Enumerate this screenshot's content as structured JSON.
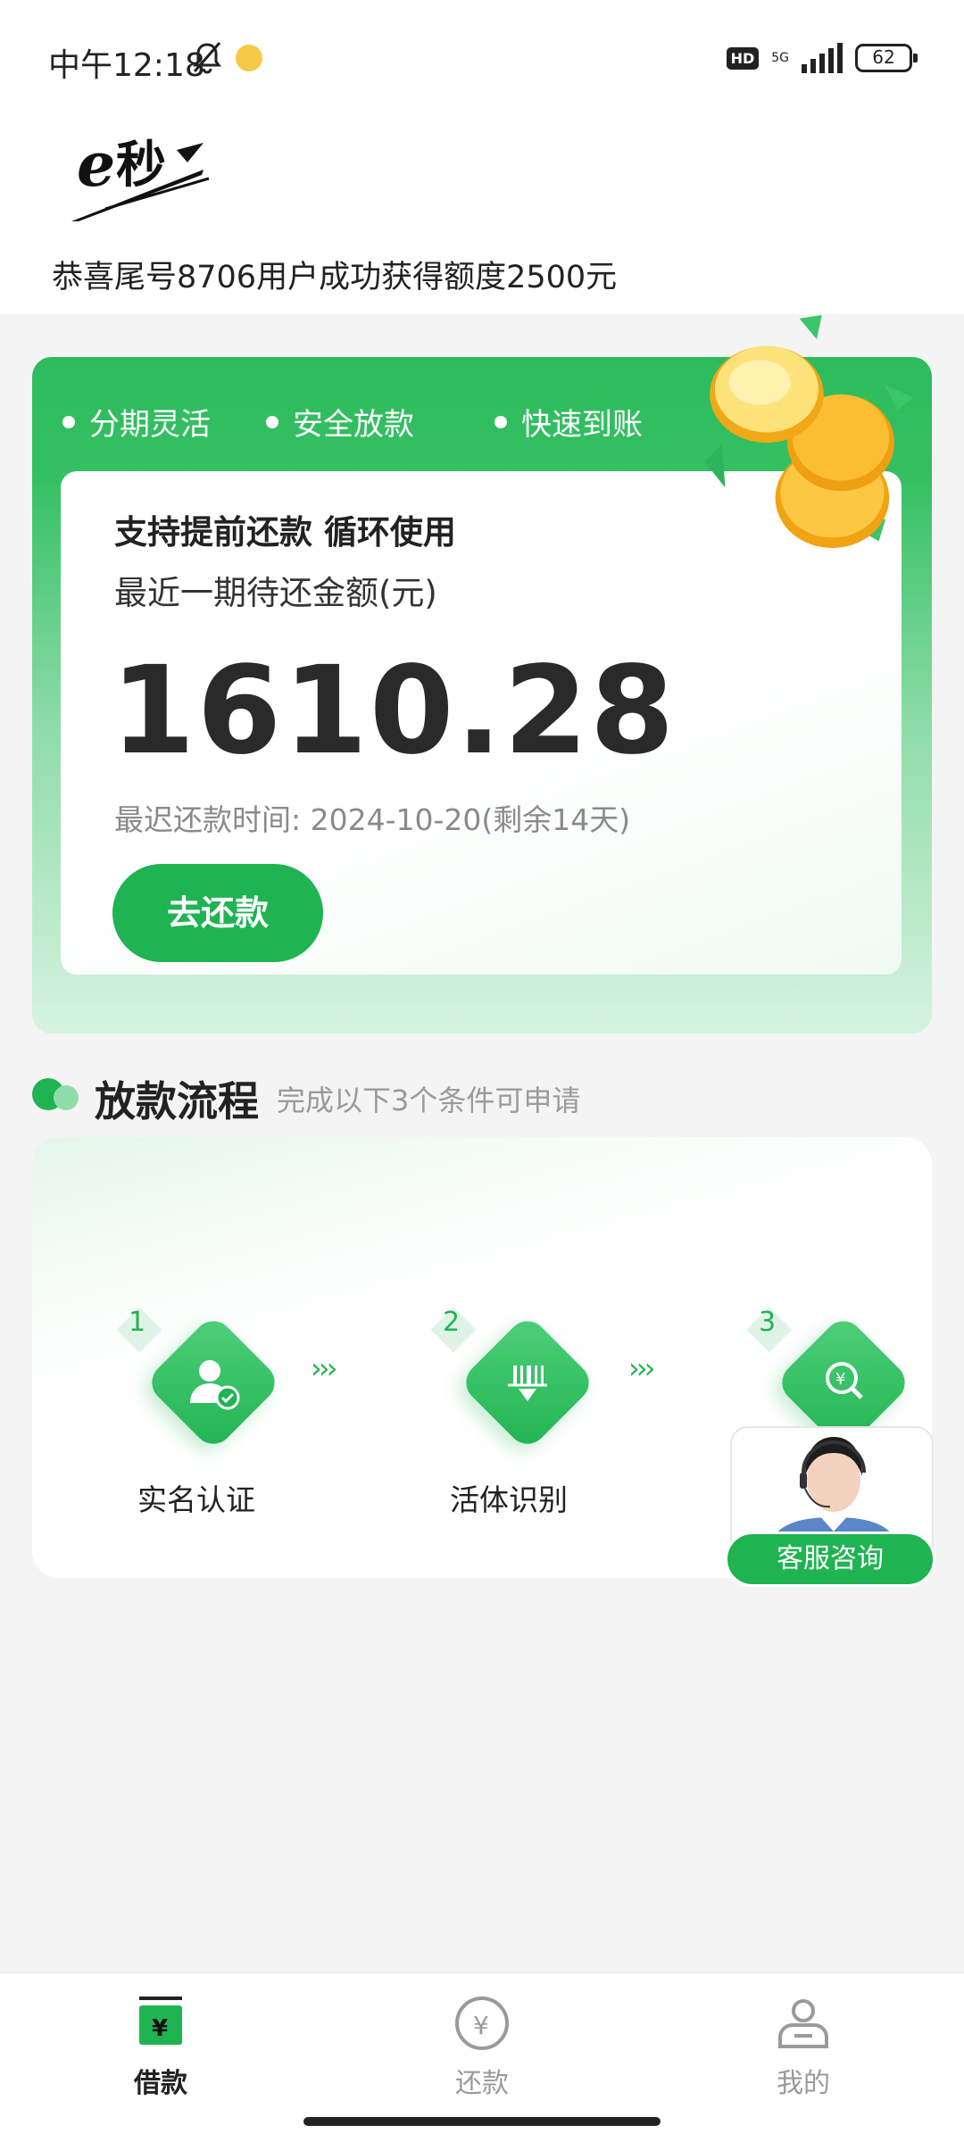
{
  "status_bar": {
    "time": "中午12:18",
    "hd": "HD",
    "network": "5G",
    "battery": "62"
  },
  "notice": "恭喜尾号8706用户成功获得额度2500元",
  "features": [
    "分期灵活",
    "安全放款",
    "快速到账"
  ],
  "loan_card": {
    "title": "支持提前还款 循环使用",
    "subtitle": "最近一期待还金额(元)",
    "amount": "1610.28",
    "due": "最迟还款时间: 2024-10-20(剩余14天)",
    "button": "去还款"
  },
  "process": {
    "title": "放款流程",
    "subtitle": "完成以下3个条件可申请",
    "steps": [
      {
        "num": "1",
        "label": "实名认证",
        "icon": "user-verify-icon"
      },
      {
        "num": "2",
        "label": "活体识别",
        "icon": "face-scan-icon"
      },
      {
        "num": "3",
        "label": "",
        "icon": "credit-search-icon"
      }
    ],
    "arrow": "›››"
  },
  "customer_service": {
    "label": "客服咨询"
  },
  "nav": {
    "items": [
      {
        "label": "借款",
        "icon": "loan-icon",
        "active": true
      },
      {
        "label": "还款",
        "icon": "repay-icon",
        "active": false
      },
      {
        "label": "我的",
        "icon": "profile-icon",
        "active": false
      }
    ]
  },
  "colors": {
    "brand_green": "#1fb352",
    "card_green": "#2dbb5d"
  }
}
